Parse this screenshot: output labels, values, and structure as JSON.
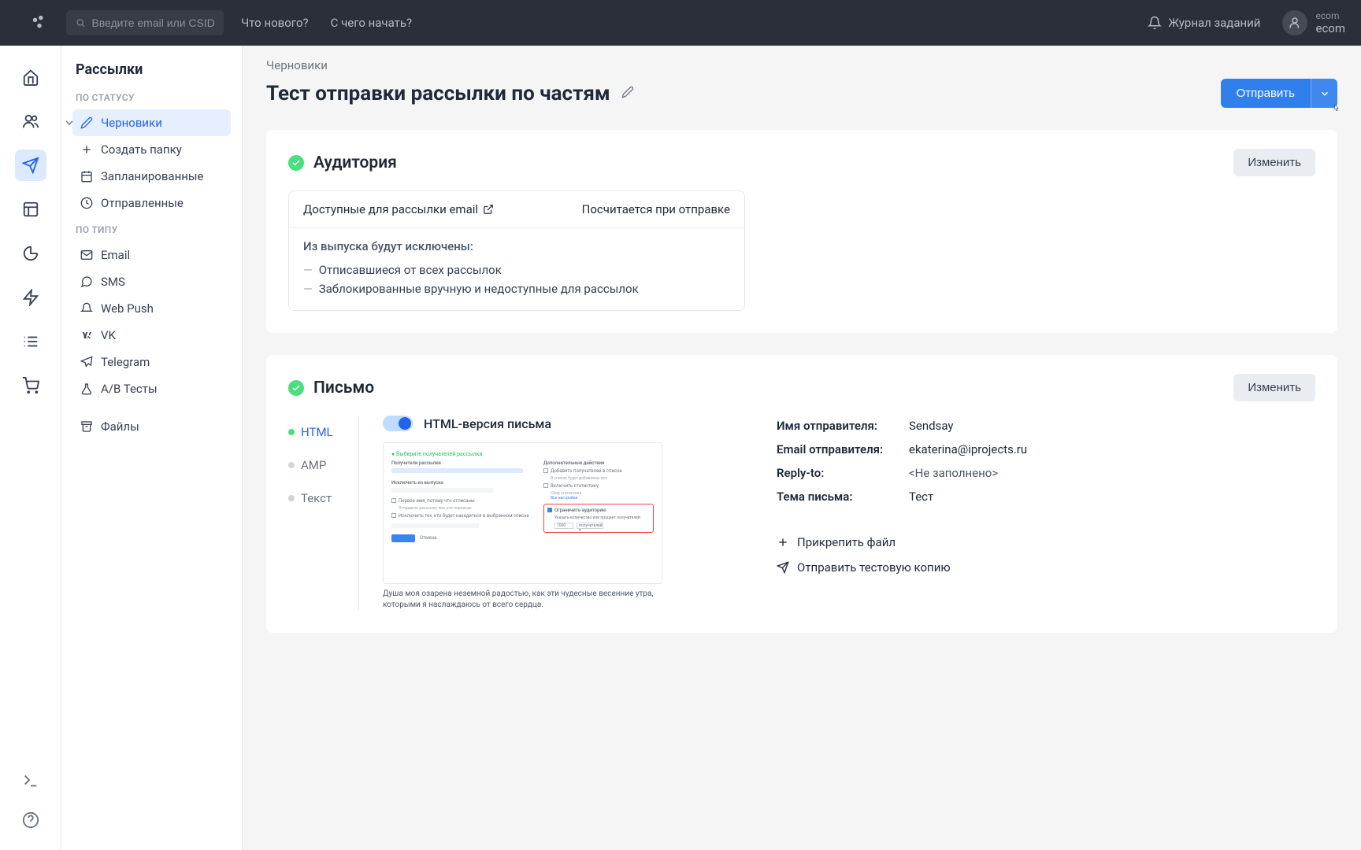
{
  "header": {
    "search_placeholder": "Введите email или CSID",
    "nav": {
      "whats_new": "Что нового?",
      "how_to_start": "С чего начать?"
    },
    "journal": "Журнал заданий",
    "user": {
      "label_small": "ecom",
      "label": "ecom"
    }
  },
  "sidebar": {
    "title": "Рассылки",
    "group_status": "ПО СТАТУСУ",
    "group_type": "ПО ТИПУ",
    "items": {
      "drafts": "Черновики",
      "create_folder": "Создать папку",
      "scheduled": "Запланированные",
      "sent": "Отправленные",
      "email": "Email",
      "sms": "SMS",
      "webpush": "Web Push",
      "vk": "VK",
      "telegram": "Telegram",
      "ab_tests": "А/В Тесты",
      "files": "Файлы"
    }
  },
  "breadcrumb": "Черновики",
  "page_title": "Тест отправки рассылки по частям",
  "send_button": "Отправить",
  "change_button": "Изменить",
  "audience": {
    "title": "Аудитория",
    "available_emails": "Доступные для рассылки email",
    "count_note": "Посчитается при отправке",
    "exclusions_title": "Из выпуска будут исключены:",
    "exclusions": [
      "Отписавшиеся от всех рассылок",
      "Заблокированные вручную и недоступные для рассылок"
    ]
  },
  "letter": {
    "title": "Письмо",
    "tabs": {
      "html": "HTML",
      "amp": "AMP",
      "text": "Текст"
    },
    "preview_label": "HTML-версия письма",
    "preview_caption": "Душа моя озарена неземной радостью, как эти чудесные весенние утра, которыми я наслаждаюсь от всего сердца.",
    "meta": {
      "sender_name_label": "Имя отправителя:",
      "sender_name": "Sendsay",
      "sender_email_label": "Email отправителя:",
      "sender_email": "ekaterina@iprojects.ru",
      "reply_to_label": "Reply-to:",
      "reply_to": "<Не заполнено>",
      "subject_label": "Тема письма:",
      "subject": "Тест"
    },
    "actions": {
      "attach": "Прикрепить файл",
      "test_copy": "Отправить тестовую копию"
    }
  }
}
